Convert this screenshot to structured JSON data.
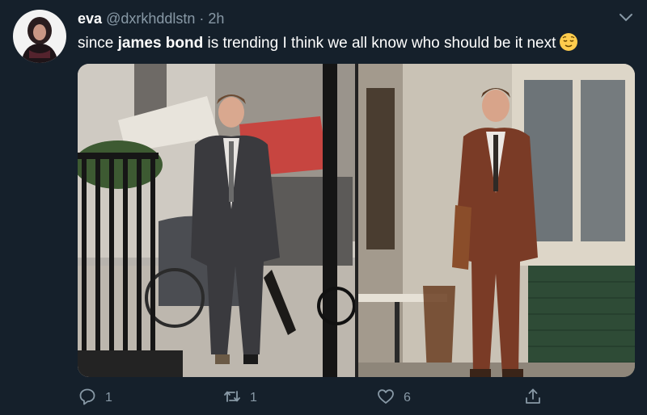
{
  "tweet": {
    "name": "eva",
    "handle": "@dxrkhddlstn",
    "separator": "·",
    "time": "2h",
    "text_before": "since ",
    "text_bold": "james bond",
    "text_after": " is trending I think we all know who should be it next",
    "emoji_icon": "relieved-face-emoji"
  },
  "actions": {
    "reply_count": "1",
    "retweet_count": "1",
    "like_count": "6"
  },
  "colors": {
    "background": "#15202b",
    "secondary_text": "#8899a6",
    "primary_text": "#ffffff"
  }
}
